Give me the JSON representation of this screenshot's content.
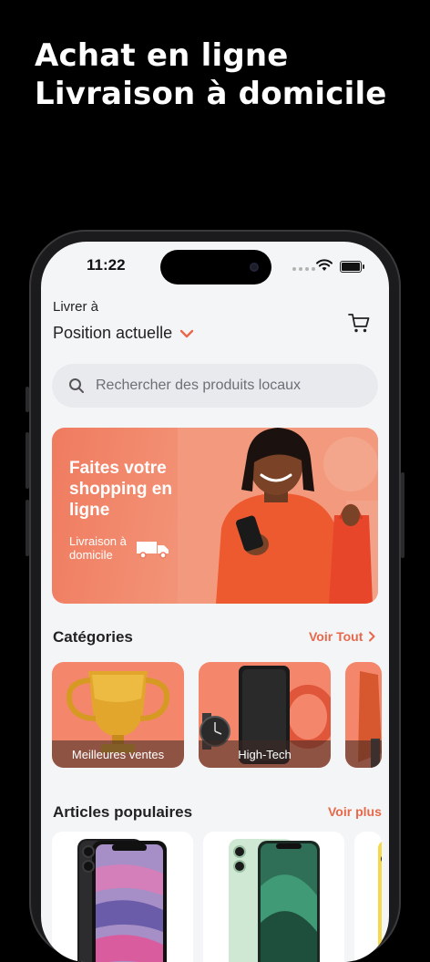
{
  "promo": {
    "headline_line1": "Achat en ligne",
    "headline_line2": "Livraison à domicile"
  },
  "status_bar": {
    "time": "11:22"
  },
  "header": {
    "deliver_label": "Livrer à",
    "location": "Position actuelle"
  },
  "search": {
    "placeholder": "Rechercher des produits locaux"
  },
  "banner": {
    "title": "Faites votre shopping en ligne",
    "subtitle": "Livraison à domicile"
  },
  "categories": {
    "title": "Catégories",
    "see_all": "Voir Tout",
    "items": [
      {
        "label": "Meilleures ventes",
        "icon": "trophy-icon"
      },
      {
        "label": "High-Tech",
        "icon": "phone-icon"
      },
      {
        "label": "",
        "icon": "fashion-icon"
      }
    ]
  },
  "popular": {
    "title": "Articles populaires",
    "see_more": "Voir plus"
  },
  "colors": {
    "accent": "#e8684a",
    "banner": "#f07b5f",
    "background": "#f4f5f7"
  }
}
